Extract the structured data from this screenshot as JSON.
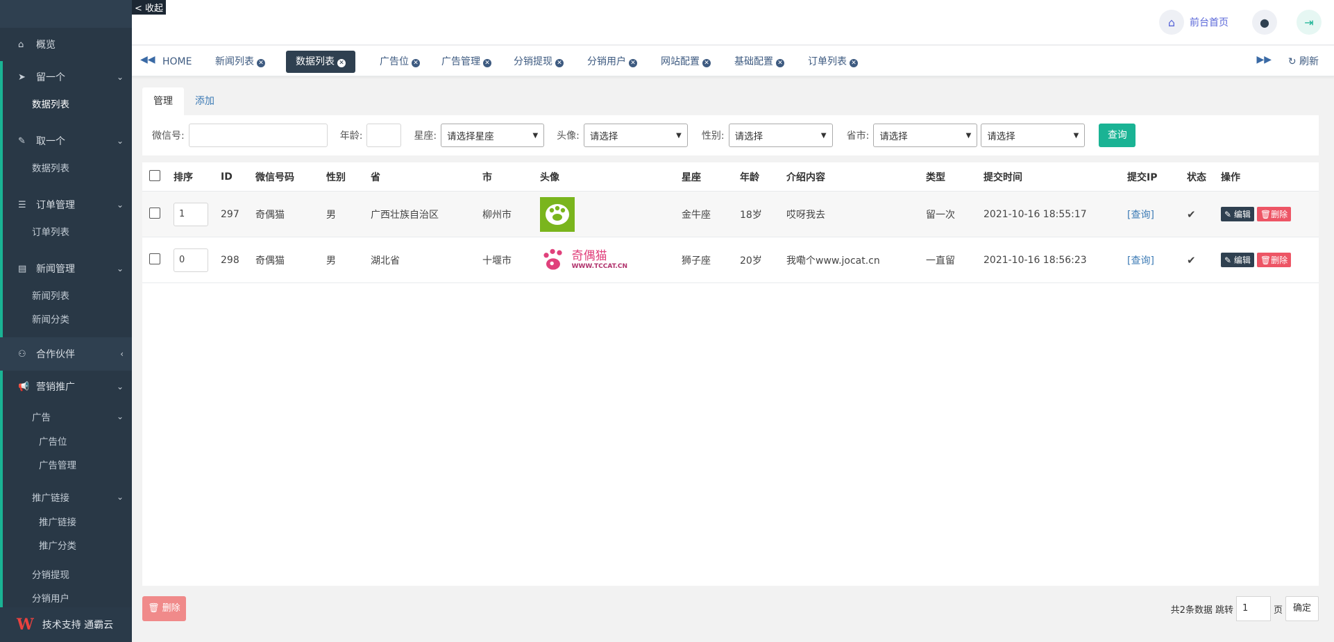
{
  "sidebar": {
    "collapse_label": "< 收起",
    "overview": "概览",
    "groups": [
      {
        "label": "留一个",
        "subs": [
          "数据列表"
        ]
      },
      {
        "label": "取一个",
        "subs": [
          "数据列表"
        ]
      },
      {
        "label": "订单管理",
        "subs": [
          "订单列表"
        ]
      },
      {
        "label": "新闻管理",
        "subs": [
          "新闻列表",
          "新闻分类"
        ]
      }
    ],
    "partner": "合作伙伴",
    "marketing": "营销推广",
    "ad": "广告",
    "ad_subs": [
      "广告位",
      "广告管理"
    ],
    "promo": "推广链接",
    "promo_subs": [
      "推广链接",
      "推广分类"
    ],
    "dist_withdraw": "分销提现",
    "dist_user": "分销用户",
    "footer": "技术支持 通霸云",
    "footer_logo": "W"
  },
  "header": {
    "front_link": "前台首页"
  },
  "tabs": {
    "items": [
      "HOME",
      "新闻列表",
      "数据列表",
      "广告位",
      "广告管理",
      "分销提现",
      "分销用户",
      "网站配置",
      "基础配置",
      "订单列表"
    ],
    "refresh": "刷新"
  },
  "subtabs": [
    "管理",
    "添加"
  ],
  "filter": {
    "wechat_label": "微信号:",
    "age_label": "年龄:",
    "star_label": "星座:",
    "star_placeholder": "请选择星座",
    "avatar_label": "头像:",
    "avatar_placeholder": "请选择",
    "gender_label": "性别:",
    "gender_placeholder": "请选择",
    "province_label": "省市:",
    "province_placeholder": "请选择",
    "city_placeholder": "请选择",
    "query": "查询"
  },
  "table": {
    "headers": [
      "排序",
      "ID",
      "微信号码",
      "性别",
      "省",
      "市",
      "头像",
      "星座",
      "年龄",
      "介绍内容",
      "类型",
      "提交时间",
      "提交IP",
      "状态",
      "操作"
    ],
    "rows": [
      {
        "sort": "1",
        "id": "297",
        "wechat": "奇偶猫",
        "gender": "男",
        "province": "广西壮族自治区",
        "city": "柳州市",
        "star": "金牛座",
        "age": "18岁",
        "intro": "哎呀我去",
        "type": "留一次",
        "time": "2021-10-16 18:55:17",
        "ip": "[查询]",
        "status": "✔",
        "edit": "编辑",
        "del": "删除"
      },
      {
        "sort": "0",
        "id": "298",
        "wechat": "奇偶猫",
        "gender": "男",
        "province": "湖北省",
        "city": "十堰市",
        "star": "狮子座",
        "age": "20岁",
        "intro": "我嘞个www.jocat.cn",
        "type": "一直留",
        "time": "2021-10-16 18:56:23",
        "ip": "[查询]",
        "status": "✔",
        "edit": "编辑",
        "del": "删除",
        "avatar_text": "奇偶猫",
        "avatar_url": "WWW.TCCAT.CN"
      }
    ]
  },
  "footer": {
    "delete_all": "删除",
    "total": "共2条数据",
    "jump": "跳转",
    "page_value": "1",
    "page_unit": "页",
    "confirm": "确定"
  },
  "colors": {
    "sidebar": "#2f4050",
    "accent": "#1ab394",
    "danger": "#ed5565",
    "link": "#3d7bb5"
  }
}
